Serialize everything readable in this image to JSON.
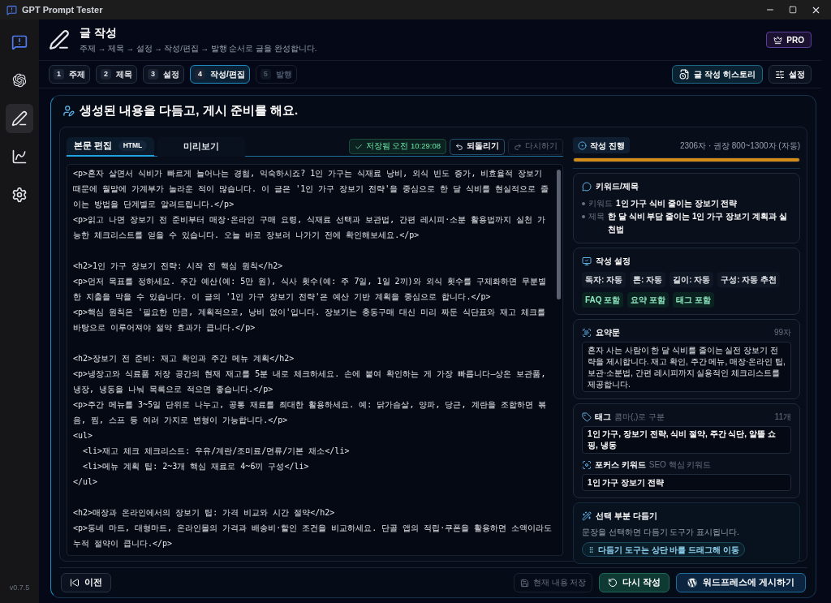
{
  "window": {
    "title": "GPT Prompt Tester"
  },
  "sidebar": {
    "items": [
      {
        "kind": "logo",
        "selected": false
      },
      {
        "kind": "ai",
        "selected": false
      },
      {
        "kind": "write",
        "selected": true
      },
      {
        "kind": "stats",
        "selected": false
      },
      {
        "kind": "settings",
        "selected": false
      }
    ],
    "version": "v0.7.5"
  },
  "header": {
    "title": "글 작성",
    "subtitle": "주제 → 제목 → 설정 → 작성/편집 → 발행 순서로 글을 완성합니다.",
    "badge": "PRO"
  },
  "steps": [
    {
      "number": "1",
      "label": "주제",
      "selected": false,
      "disabled": false
    },
    {
      "number": "2",
      "label": "제목",
      "selected": false,
      "disabled": false
    },
    {
      "number": "3",
      "label": "설정",
      "selected": false,
      "disabled": false
    },
    {
      "number": "4",
      "label": "작성/편집",
      "selected": true,
      "disabled": false
    },
    {
      "number": "5",
      "label": "발행",
      "selected": false,
      "disabled": true
    }
  ],
  "toolbar": {
    "history_button": "글 작성 히스토리",
    "settings_button": "설정"
  },
  "card": {
    "heading": "생성된 내용을 다듬고, 게시 준비를 해요."
  },
  "editor": {
    "tabs": [
      {
        "label": "본문 편집",
        "badge": "HTML",
        "selected": true
      },
      {
        "label": "미리보기",
        "selected": false
      }
    ],
    "save_status": "저장됨 오전 10:29:08",
    "undo": {
      "label": "되돌리기",
      "disabled": false
    },
    "redo": {
      "label": "다시하기",
      "disabled": true
    },
    "content": "<p>혼자 살면서 식비가 빠르게 늘어나는 경험, 익숙하시죠? 1인 가구는 식재료 낭비, 외식 빈도 증가, 비효율적 장보기 때문에 월말에 가계부가 놀라운 적이 많습니다. 이 글은 '1인 가구 장보기 전략'을 중심으로 한 달 식비를 현실적으로 줄이는 방법을 단계별로 알려드립니다.</p>\n<p>읽고 나면 장보기 전 준비부터 매장·온라인 구매 요령, 식재료 선택과 보관법, 간편 레시피·소분 활용법까지 실천 가능한 체크리스트를 얻을 수 있습니다. 오늘 바로 장보러 나가기 전에 확인해보세요.</p>\n\n<h2>1인 가구 장보기 전략: 시작 전 핵심 원칙</h2>\n<p>먼저 목표를 정하세요. 주간 예산(예: 5만 원), 식사 횟수(예: 주 7일, 1일 2끼)와 외식 횟수를 구체화하면 무분별한 지출을 막을 수 있습니다. 이 글의 '1인 가구 장보기 전략'은 예산 기반 계획을 중심으로 합니다.</p>\n<p>핵심 원칙은 '필요한 만큼, 계획적으로, 낭비 없이'입니다. 장보기는 충동구매 대신 미리 짜둔 식단표와 재고 체크를 바탕으로 이루어져야 절약 효과가 큽니다.</p>\n\n<h2>장보기 전 준비: 재고 확인과 주간 메뉴 계획</h2>\n<p>냉장고와 식료품 저장 공간의 현재 재고를 5분 내로 체크하세요. 손에 붙여 확인하는 게 가장 빠릅니다—상온 보관품, 냉장, 냉동을 나눠 목록으로 적으면 좋습니다.</p>\n<p>주간 메뉴를 3~5일 단위로 나누고, 공통 재료를 최대한 활용하세요. 예: 닭가슴살, 양파, 당근, 계란을 조합하면 볶음, 찜, 스프 등 여러 가지로 변형이 가능합니다.</p>\n<ul>\n  <li>재고 체크 체크리스트: 우유/계란/조미료/면류/기본 채소</li>\n  <li>메뉴 계획 팁: 2~3개 핵심 재료로 4~6끼 구성</li>\n</ul>\n\n<h2>매장과 온라인에서의 장보기 팁: 가격 비교와 시간 절약</h2>\n<p>동네 마트, 대형마트, 온라인몰의 가격과 배송비·할인 조건을 비교하세요. 단골 앱의 적립·쿠폰을 활용하면 소액이라도 누적 절약이 큽니다.</p>"
  },
  "progress": {
    "label": "작성 진행",
    "reading": "2306자 · 권장 800~1300자 (자동)",
    "level": 1
  },
  "keyword_card": {
    "title": "키워드/제목",
    "rows": [
      {
        "label": "키워드",
        "value": "1인 가구 식비 줄이는 장보기 전략"
      },
      {
        "label": "제목",
        "value": "한 달 식비 부담 줄이는 1인 가구 장보기 계획과 실천법"
      }
    ]
  },
  "settings_card": {
    "title": "작성 설정",
    "chips": [
      {
        "kind": "setting",
        "label": "독자: 자동"
      },
      {
        "kind": "setting",
        "label": "톤: 자동"
      },
      {
        "kind": "setting",
        "label": "길이: 자동"
      },
      {
        "kind": "setting",
        "label": "구성: 자동 추천"
      },
      {
        "kind": "option",
        "label": "FAQ 포함"
      },
      {
        "kind": "option",
        "label": "요약 포함"
      },
      {
        "kind": "option",
        "label": "태그 포함"
      }
    ]
  },
  "summary_card": {
    "title": "요약문",
    "count": "99자",
    "text": "혼자 사는 사람이 한 달 식비를 줄이는 실전 장보기 전략을 제시합니다. 재고 확인, 주간 메뉴, 매장·온라인 팁, 보관·소분법, 간편 레시피까지 실용적인 체크리스트를 제공합니다."
  },
  "tags_card": {
    "title": "태그",
    "hint": "콤마(,)로 구분",
    "count": "11개",
    "value": "1인 가구, 장보기 전략, 식비 절약, 주간 식단, 알뜰 쇼핑, 냉동",
    "focus_title": "포커스 키워드",
    "focus_hint": "SEO 핵심 키워드",
    "focus_value": "1인 가구 장보기 전략"
  },
  "refine_card": {
    "title": "선택 부분 다듬기",
    "text": "문장을 선택하면 다듬기 도구가 표시됩니다.",
    "pill": "다듬기 도구는 상단 바를 드래그해 이동"
  },
  "footer": {
    "prev_button": "이전",
    "save_button": {
      "label": "현재 내용 저장",
      "disabled": true
    },
    "rewrite_button": "다시 작성",
    "publish_button": "워드프레스에 게시하기"
  }
}
